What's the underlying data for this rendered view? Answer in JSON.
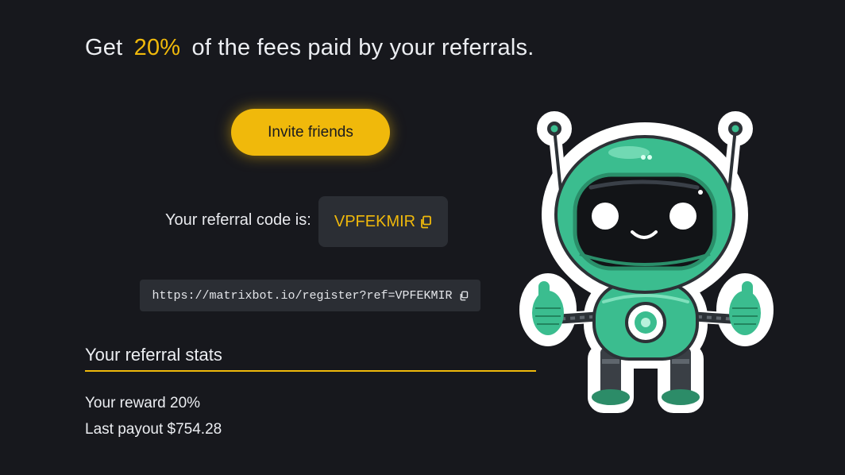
{
  "headline": {
    "before": "Get",
    "highlight": "20%",
    "after": "of the fees paid by your referrals."
  },
  "invite": {
    "label": "Invite friends"
  },
  "referral": {
    "code_label": "Your referral code is:",
    "code": "VPFEKMIR",
    "link": "https://matrixbot.io/register?ref=VPFEKMIR"
  },
  "stats": {
    "title": "Your referral stats",
    "reward_label": "Your reward",
    "reward_value": "20%",
    "payout_label": "Last payout",
    "payout_value": "$754.28"
  },
  "icons": {
    "copy": "copy-icon",
    "mascot": "robot-mascot"
  },
  "colors": {
    "accent": "#f0b90b",
    "background": "#17181d",
    "panel": "#2b2e34",
    "robot": "#3bbd8f"
  }
}
